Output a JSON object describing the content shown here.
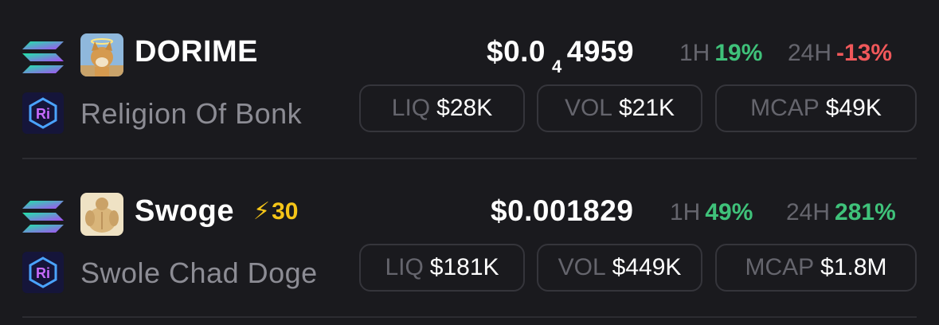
{
  "tokens": [
    {
      "symbol": "DORIME",
      "name": "Religion Of Bonk",
      "boost": "",
      "price_main": "$0.0",
      "price_sub": "4",
      "price_tail": "4959",
      "change_1h_label": "1H",
      "change_1h": "19%",
      "change_24h_label": "24H",
      "change_24h": "-13%",
      "liq_label": "LIQ",
      "liq": "$28K",
      "vol_label": "VOL",
      "vol": "$21K",
      "mcap_label": "MCAP",
      "mcap": "$49K"
    },
    {
      "symbol": "Swoge",
      "name": "Swole Chad Doge",
      "boost": "30",
      "price_main": "$0.001829",
      "price_sub": "",
      "price_tail": "",
      "change_1h_label": "1H",
      "change_1h": "49%",
      "change_24h_label": "24H",
      "change_24h": "281%",
      "liq_label": "LIQ",
      "liq": "$181K",
      "vol_label": "VOL",
      "vol": "$449K",
      "mcap_label": "MCAP",
      "mcap": "$1.8M"
    }
  ],
  "icons": {
    "chain": "solana-icon",
    "dex": "raydium-icon",
    "boost": "lightning-bolt-icon"
  },
  "colors": {
    "background": "#1a1a1e",
    "positive": "#3fc27a",
    "negative": "#f0585a",
    "boost": "#f5c518",
    "muted": "#8c8c94"
  }
}
